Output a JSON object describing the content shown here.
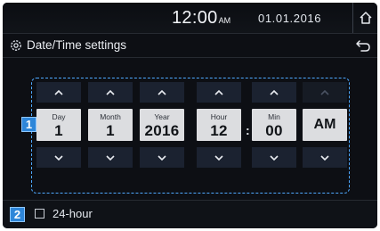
{
  "status_bar": {
    "time": "12:00",
    "ampm": "AM",
    "date": "01.01.2016",
    "home_icon": "home-icon"
  },
  "header": {
    "title": "Date/Time settings",
    "settings_icon": "gear-icon",
    "back_icon": "back-arrow-icon"
  },
  "callouts": {
    "picker": "1",
    "hour_format": "2"
  },
  "picker": {
    "columns": [
      {
        "label": "Day",
        "value": "1"
      },
      {
        "label": "Month",
        "value": "1"
      },
      {
        "label": "Year",
        "value": "2016"
      },
      {
        "label": "Hour",
        "value": "12"
      },
      {
        "label": "Min",
        "value": "00"
      },
      {
        "label": "",
        "value": "AM"
      }
    ],
    "separator": ":"
  },
  "options": {
    "hour24_label": "24-hour",
    "hour24_checked": false
  },
  "colors": {
    "accent": "#2e86d9",
    "dashed_outline": "#4ea8ff",
    "arrow_bg": "#1b2230",
    "value_bg": "#dcdde0"
  }
}
